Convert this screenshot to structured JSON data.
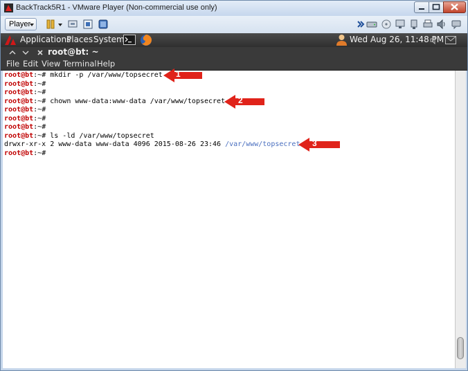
{
  "window": {
    "title": "BackTrack5R1 - VMware Player (Non-commercial use only)",
    "close_color": "#c2452d"
  },
  "toolbar": {
    "player_label": "Player",
    "icons": [
      "pause-icon",
      "send-ctrl-alt-del-icon",
      "fullscreen-icon",
      "unity-icon"
    ],
    "right_icons": [
      "chevron-right-icon",
      "hdd-icon",
      "cdrom-icon",
      "network-icon",
      "usb-icon",
      "printer-icon",
      "sound-icon",
      "message-icon"
    ]
  },
  "panel": {
    "applications": "Applications",
    "places": "Places",
    "system": "System",
    "clock": "Wed Aug 26, 11:48 PM"
  },
  "terminal": {
    "tab_title": "root@bt: ~",
    "menu": {
      "file": "File",
      "edit": "Edit",
      "view": "View",
      "terminal": "Terminal",
      "help": "Help"
    },
    "prompt_user": "root@bt",
    "prompt_path": ":~#",
    "lines": [
      {
        "prompt": true,
        "cmd": " mkdir -p /var/www/topsecret"
      },
      {
        "prompt": true,
        "cmd": ""
      },
      {
        "prompt": true,
        "cmd": ""
      },
      {
        "prompt": true,
        "cmd": " chown www-data:www-data /var/www/topsecret"
      },
      {
        "prompt": true,
        "cmd": ""
      },
      {
        "prompt": true,
        "cmd": ""
      },
      {
        "prompt": true,
        "cmd": ""
      },
      {
        "prompt": true,
        "cmd": " ls -ld /var/www/topsecret"
      },
      {
        "prompt": false,
        "cmd": "drwxr-xr-x 2 www-data www-data 4096 2015-08-26 23:46 ",
        "highlight": "/var/www/topsecret"
      },
      {
        "prompt": true,
        "cmd": ""
      }
    ],
    "colors": {
      "prompt": "#c00000",
      "highlight_path": "#4a6fbf",
      "background": "#ffffff"
    }
  },
  "callouts": [
    {
      "label": "1"
    },
    {
      "label": "2"
    },
    {
      "label": "3"
    }
  ],
  "callout_color": "#e0231a"
}
